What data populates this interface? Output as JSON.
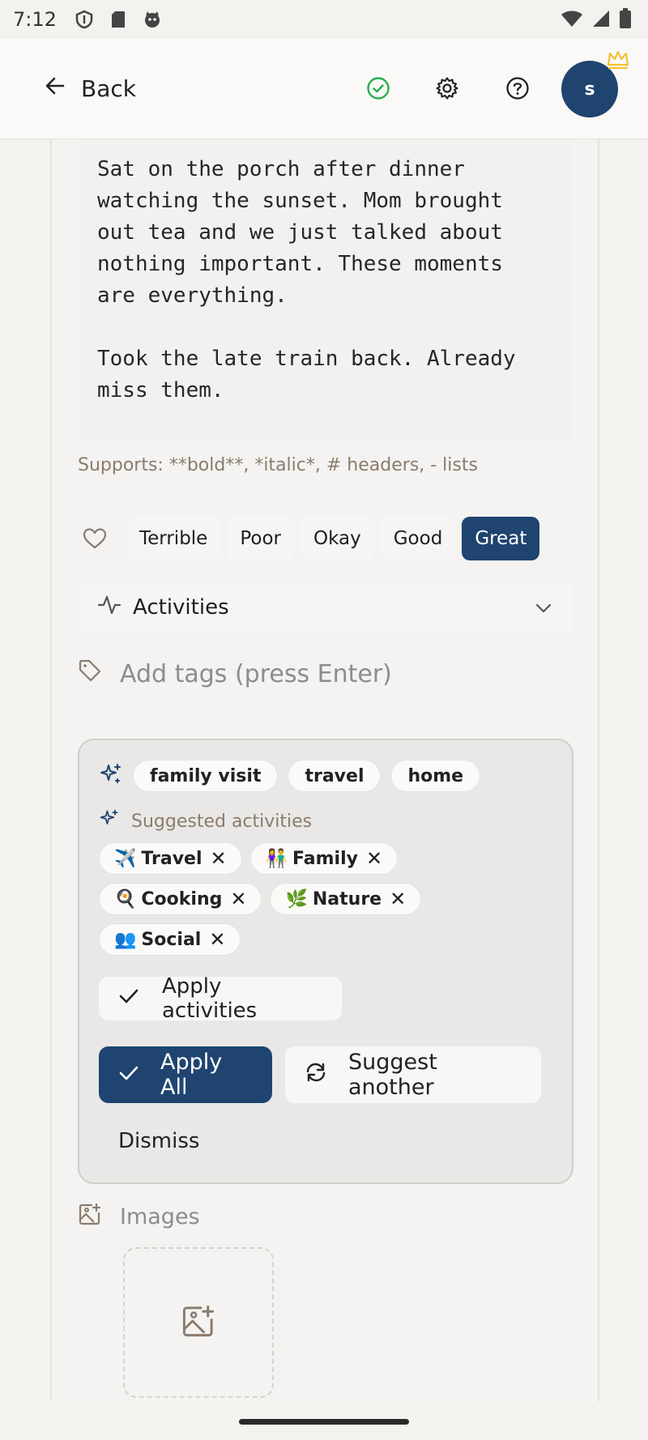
{
  "status_bar": {
    "time": "7:12"
  },
  "header": {
    "back_label": "Back",
    "avatar_initial": "s"
  },
  "editor": {
    "body": "Sat on the porch after dinner\nwatching the sunset. Mom brought\nout tea and we just talked about\nnothing important. These moments\nare everything.\n\nTook the late train back. Already\nmiss them."
  },
  "supports_hint": "Supports: **bold**, *italic*, # headers, - lists",
  "mood": {
    "options": [
      "Terrible",
      "Poor",
      "Okay",
      "Good",
      "Great"
    ],
    "selected": "Great"
  },
  "activities": {
    "label": "Activities"
  },
  "tags": {
    "placeholder": "Add tags (press Enter)"
  },
  "suggestions": {
    "tags": [
      "family visit",
      "travel",
      "home"
    ],
    "suggested_label": "Suggested activities",
    "activities": [
      {
        "emoji": "✈️",
        "label": "Travel"
      },
      {
        "emoji": "👫",
        "label": "Family"
      },
      {
        "emoji": "🍳",
        "label": "Cooking"
      },
      {
        "emoji": "🌿",
        "label": "Nature"
      },
      {
        "emoji": "👥",
        "label": "Social"
      }
    ],
    "apply_activities": "Apply activities",
    "apply_all": "Apply All",
    "suggest_another": "Suggest another",
    "dismiss": "Dismiss"
  },
  "images": {
    "label": "Images"
  },
  "colors": {
    "accent": "#1f4470",
    "success": "#22b14c",
    "crown": "#f1c232",
    "muted": "#8b7b6d"
  },
  "icons": [
    "back-arrow-icon",
    "check-circle-icon",
    "gear-icon",
    "help-icon",
    "crown-icon",
    "heart-icon",
    "activity-icon",
    "chevron-down-icon",
    "tag-icon",
    "sparkles-icon",
    "check-icon",
    "refresh-icon",
    "image-add-icon"
  ]
}
